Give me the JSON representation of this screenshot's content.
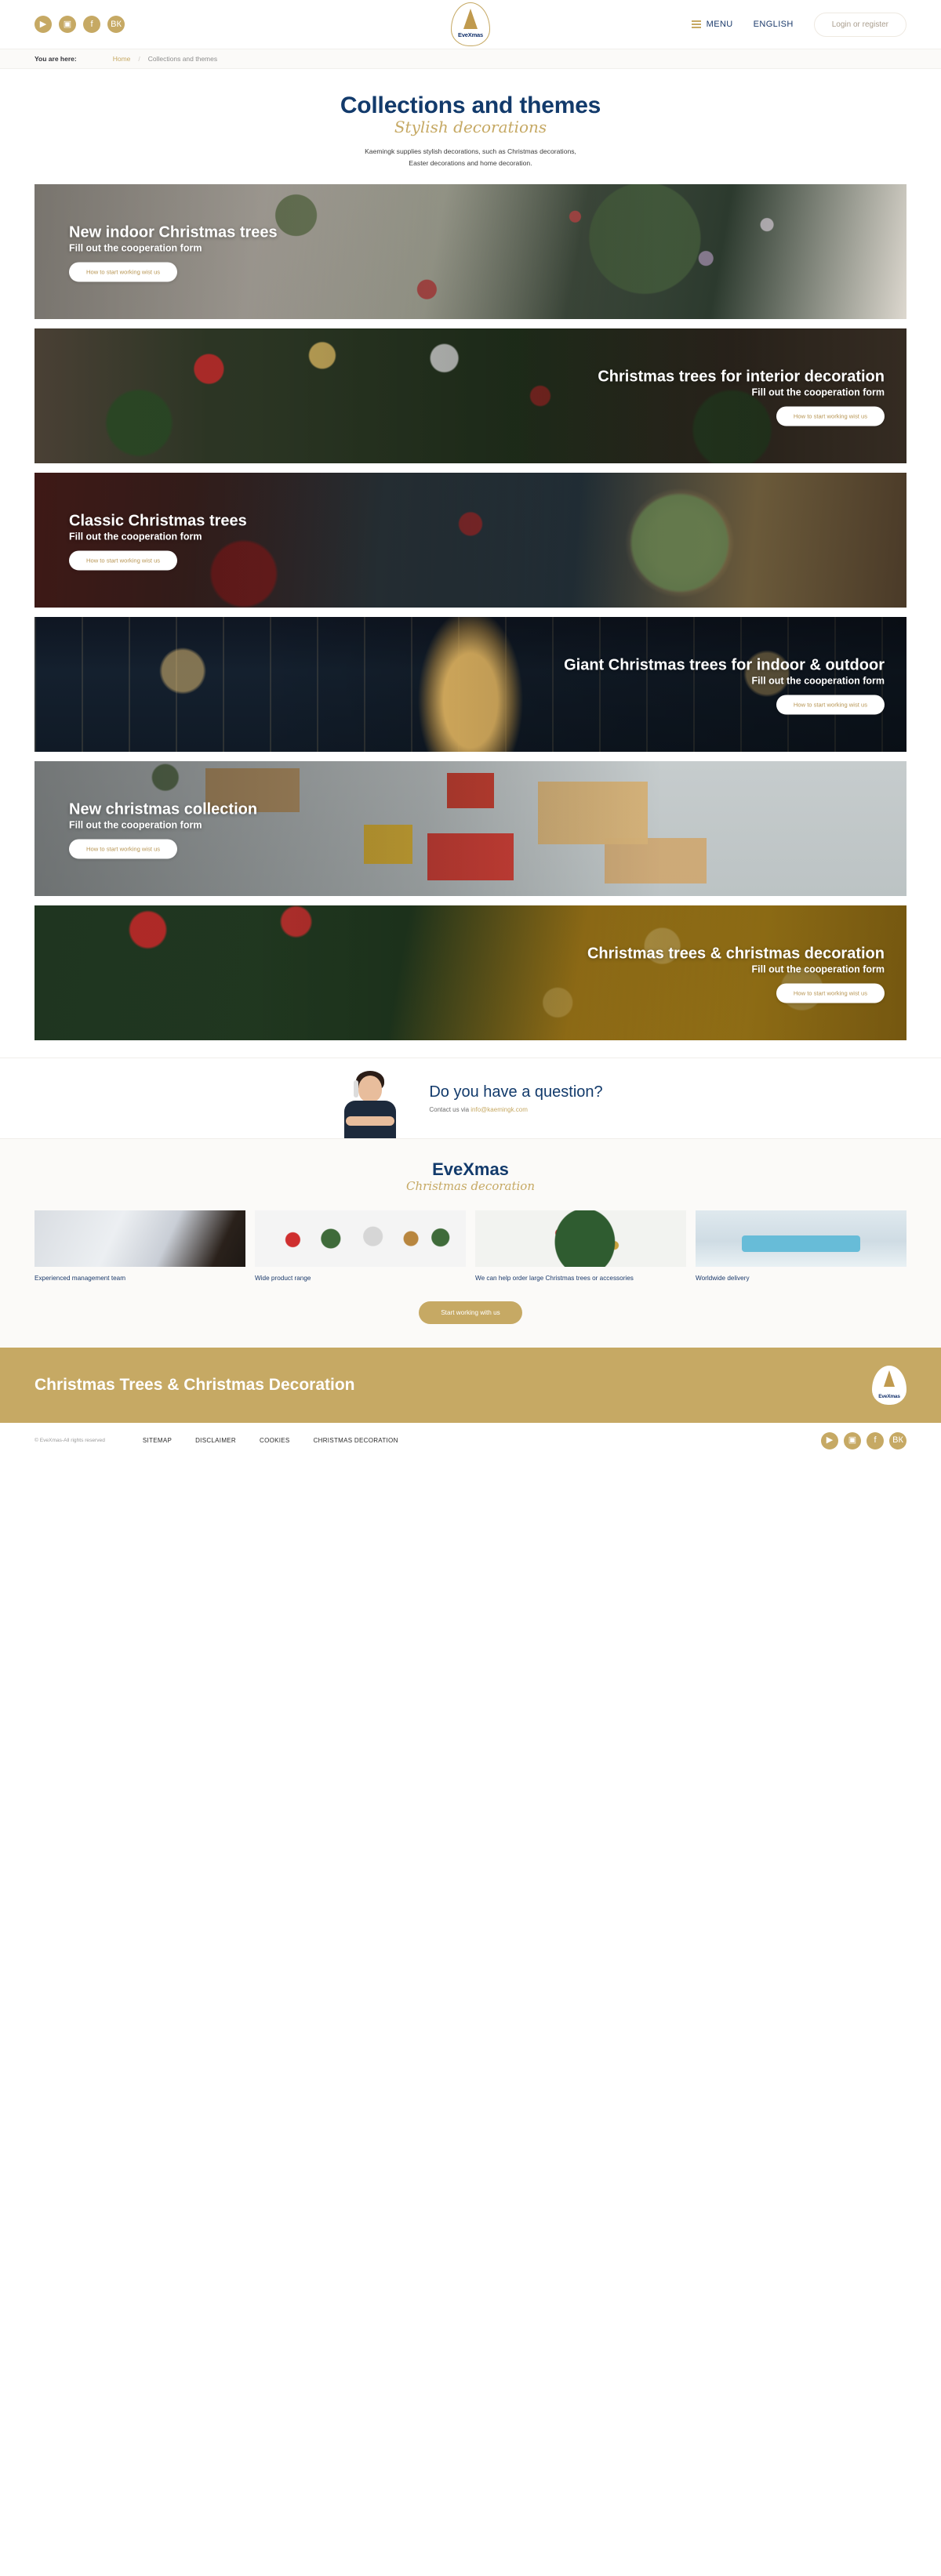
{
  "header": {
    "social": [
      {
        "name": "youtube-icon",
        "glyph": "▶"
      },
      {
        "name": "instagram-icon",
        "glyph": "▣"
      },
      {
        "name": "facebook-icon",
        "glyph": "f"
      },
      {
        "name": "vk-icon",
        "glyph": "ВК"
      }
    ],
    "logo_word": "EveXmas",
    "menu_label": "MENU",
    "language_label": "ENGLISH",
    "login_label": "Login or register"
  },
  "breadcrumb": {
    "here_label": "You are here:",
    "home": "Home",
    "separator": "/",
    "current": "Collections and themes"
  },
  "page": {
    "title": "Collections and themes",
    "subtitle": "Stylish decorations",
    "description_line1": "Kaemingk supplies stylish decorations, such as Christmas decorations,",
    "description_line2": "Easter decorations and home decoration."
  },
  "banners": [
    {
      "title": "New indoor Christmas trees",
      "subtitle": "Fill out the cooperation form",
      "cta": "How to start working wist us",
      "align": "left",
      "art": "b1"
    },
    {
      "title": "Christmas trees for interior decoration",
      "subtitle": "Fill out the cooperation form",
      "cta": "How to start working wist us",
      "align": "right",
      "art": "b2"
    },
    {
      "title": "Classic Christmas trees",
      "subtitle": "Fill out the cooperation form",
      "cta": "How to start working wist us",
      "align": "left",
      "art": "b3"
    },
    {
      "title": "Giant Christmas trees for indoor & outdoor",
      "subtitle": "Fill out the cooperation form",
      "cta": "How to start working wist us",
      "align": "right",
      "art": "b4"
    },
    {
      "title": "New christmas collection",
      "subtitle": "Fill out the cooperation form",
      "cta": "How to start working wist us",
      "align": "left",
      "art": "b5"
    },
    {
      "title": "Christmas trees & christmas decoration",
      "subtitle": "Fill out the cooperation form",
      "cta": "How to start working wist us",
      "align": "right",
      "art": "b6"
    }
  ],
  "question": {
    "title": "Do you have a question?",
    "contact_prefix": "Contact us via ",
    "email": "info@kaemingk.com"
  },
  "brand": {
    "name": "EveXmas",
    "tagline": "Christmas decoration",
    "features": [
      {
        "caption": "Experienced management team",
        "art": "f1"
      },
      {
        "caption": "Wide product range",
        "art": "f2"
      },
      {
        "caption": "We can help order large Christmas trees or accessories",
        "art": "f3"
      },
      {
        "caption": "Worldwide delivery",
        "art": "f4"
      }
    ],
    "cta": "Start working with us"
  },
  "footer": {
    "title": "Christmas Trees & Christmas  Decoration",
    "logo_word": "EveXmas",
    "copyright": "© EveXmas-All rights reserved",
    "links": [
      "SITEMAP",
      "DISCLAIMER",
      "COOKIES",
      "CHRISTMAS DECORATION"
    ],
    "social": [
      {
        "name": "youtube-icon",
        "glyph": "▶"
      },
      {
        "name": "instagram-icon",
        "glyph": "▣"
      },
      {
        "name": "facebook-icon",
        "glyph": "f"
      },
      {
        "name": "vk-icon",
        "glyph": "ВК"
      }
    ]
  },
  "colors": {
    "gold": "#c6a964",
    "navy": "#123a6b",
    "band": "#fbfaf8"
  }
}
